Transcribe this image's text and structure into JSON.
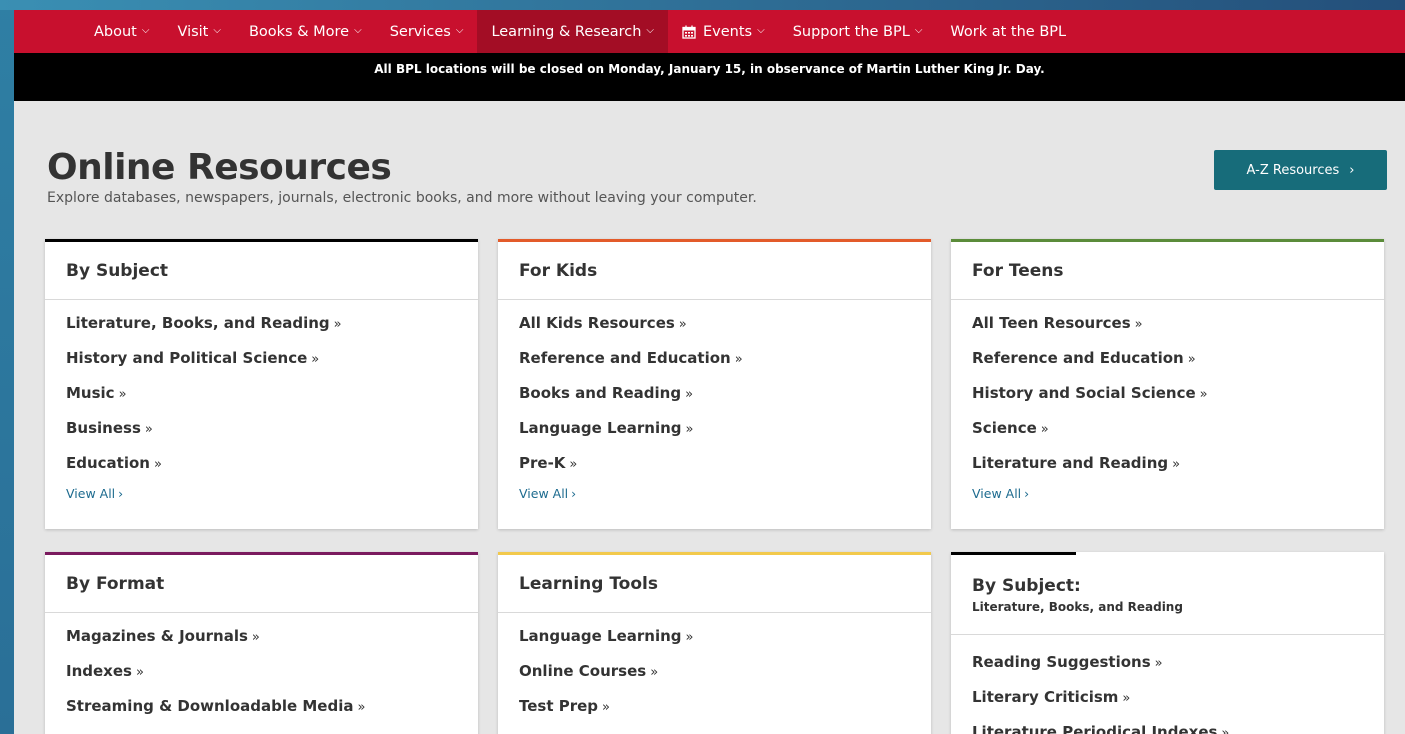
{
  "nav": {
    "items": [
      {
        "label": "About",
        "dropdown": true
      },
      {
        "label": "Visit",
        "dropdown": true
      },
      {
        "label": "Books & More",
        "dropdown": true
      },
      {
        "label": "Services",
        "dropdown": true
      },
      {
        "label": "Learning & Research",
        "dropdown": true,
        "active": true
      },
      {
        "label": "Events",
        "dropdown": true,
        "icon": "calendar-icon"
      },
      {
        "label": "Support the BPL",
        "dropdown": true
      },
      {
        "label": "Work at the BPL",
        "dropdown": false
      }
    ],
    "chevron_glyph": "⌵",
    "colors": {
      "nav_bg": "#c8102e",
      "active_bg": "#a30d25"
    }
  },
  "alert": {
    "text": "All BPL locations will be closed on Monday, January 15, in observance of Martin Luther King Jr. Day."
  },
  "header": {
    "title": "Online Resources",
    "subtitle": "Explore databases, newspapers, journals, electronic books, and more without leaving your computer.",
    "az_button": "A-Z Resources",
    "arrow": "›"
  },
  "cards": {
    "by_subject": {
      "title": "By Subject",
      "accent": "#000000",
      "links": [
        "Literature, Books, and Reading",
        "History and Political Science",
        "Music",
        "Business",
        "Education"
      ],
      "view_all": "View All"
    },
    "for_kids": {
      "title": "For Kids",
      "accent": "#e35b2a",
      "links": [
        "All Kids Resources",
        "Reference and Education",
        "Books and Reading",
        "Language Learning",
        "Pre-K"
      ],
      "view_all": "View All"
    },
    "for_teens": {
      "title": "For Teens",
      "accent": "#5b8c3a",
      "links": [
        "All Teen Resources",
        "Reference and Education",
        "History and Social Science",
        "Science",
        "Literature and Reading"
      ],
      "view_all": "View All"
    },
    "by_format": {
      "title": "By Format",
      "accent": "#7a1a5e",
      "links": [
        "Magazines & Journals",
        "Indexes",
        "Streaming & Downloadable Media"
      ]
    },
    "learning_tools": {
      "title": "Learning Tools",
      "accent": "#f2c94c",
      "links": [
        "Language Learning",
        "Online Courses",
        "Test Prep"
      ]
    },
    "by_subject_lit": {
      "title": "By Subject:",
      "subtitle": "Literature, Books, and Reading",
      "accent": "#000000",
      "links": [
        "Reading Suggestions",
        "Literary Criticism",
        "Literature Periodical Indexes"
      ]
    }
  },
  "glyphs": {
    "link_arrow": "»",
    "view_all_arrow": "›"
  }
}
